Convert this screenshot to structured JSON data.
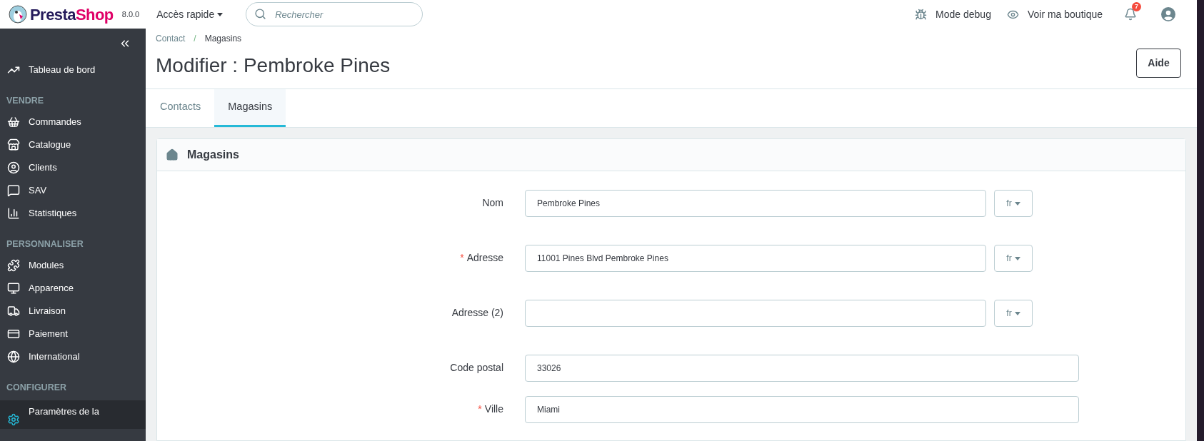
{
  "topbar": {
    "logo": [
      "Presta",
      "Shop"
    ],
    "version": "8.0.0",
    "quick_access": "Accès rapide",
    "search": {
      "placeholder": "Rechercher"
    },
    "actions": [
      {
        "kind": "debug",
        "label": "Mode debug"
      },
      {
        "kind": "view",
        "label": "Voir ma boutique"
      }
    ],
    "notifications": {
      "count": "7"
    }
  },
  "sidebar": {
    "items": [
      {
        "kind": "link",
        "label": "Tableau de bord",
        "selected": false
      },
      {
        "kind": "heading",
        "label": "VENDRE"
      },
      {
        "kind": "link",
        "label": "Commandes",
        "selected": false
      },
      {
        "kind": "link",
        "label": "Catalogue",
        "selected": false
      },
      {
        "kind": "link",
        "label": "Clients",
        "selected": false
      },
      {
        "kind": "link",
        "label": "SAV",
        "selected": false
      },
      {
        "kind": "link",
        "label": "Statistiques",
        "selected": false
      },
      {
        "kind": "heading",
        "label": "PERSONNALISER"
      },
      {
        "kind": "link",
        "label": "Modules",
        "selected": false
      },
      {
        "kind": "link",
        "label": "Apparence",
        "selected": false
      },
      {
        "kind": "link",
        "label": "Livraison",
        "selected": false
      },
      {
        "kind": "link",
        "label": "Paiement",
        "selected": false
      },
      {
        "kind": "link",
        "label": "International",
        "selected": false
      },
      {
        "kind": "heading",
        "label": "CONFIGURER"
      },
      {
        "kind": "link",
        "label": "Paramètres de la",
        "selected": true
      }
    ]
  },
  "header": {
    "breadcrumb": [
      "Contact",
      "Magasins"
    ],
    "breadcrumb_separator": "/",
    "title": "Modifier : Pembroke Pines",
    "help_button": "Aide"
  },
  "tabs": [
    {
      "label": "Contacts",
      "selected": false
    },
    {
      "label": "Magasins",
      "selected": true
    }
  ],
  "panel": {
    "title": "Magasins",
    "required_mark": "*",
    "fields": [
      {
        "label": "Nom",
        "required": false,
        "value": "Pembroke Pines",
        "lang": "fr"
      },
      {
        "label": "Adresse",
        "required": true,
        "value": "11001 Pines Blvd Pembroke Pines",
        "lang": "fr"
      },
      {
        "label": "Adresse (2)",
        "required": false,
        "lang": "fr"
      },
      {
        "label": "Code postal",
        "required": false,
        "value": "33026"
      },
      {
        "label": "Ville",
        "required": true,
        "value": "Miami"
      }
    ]
  }
}
